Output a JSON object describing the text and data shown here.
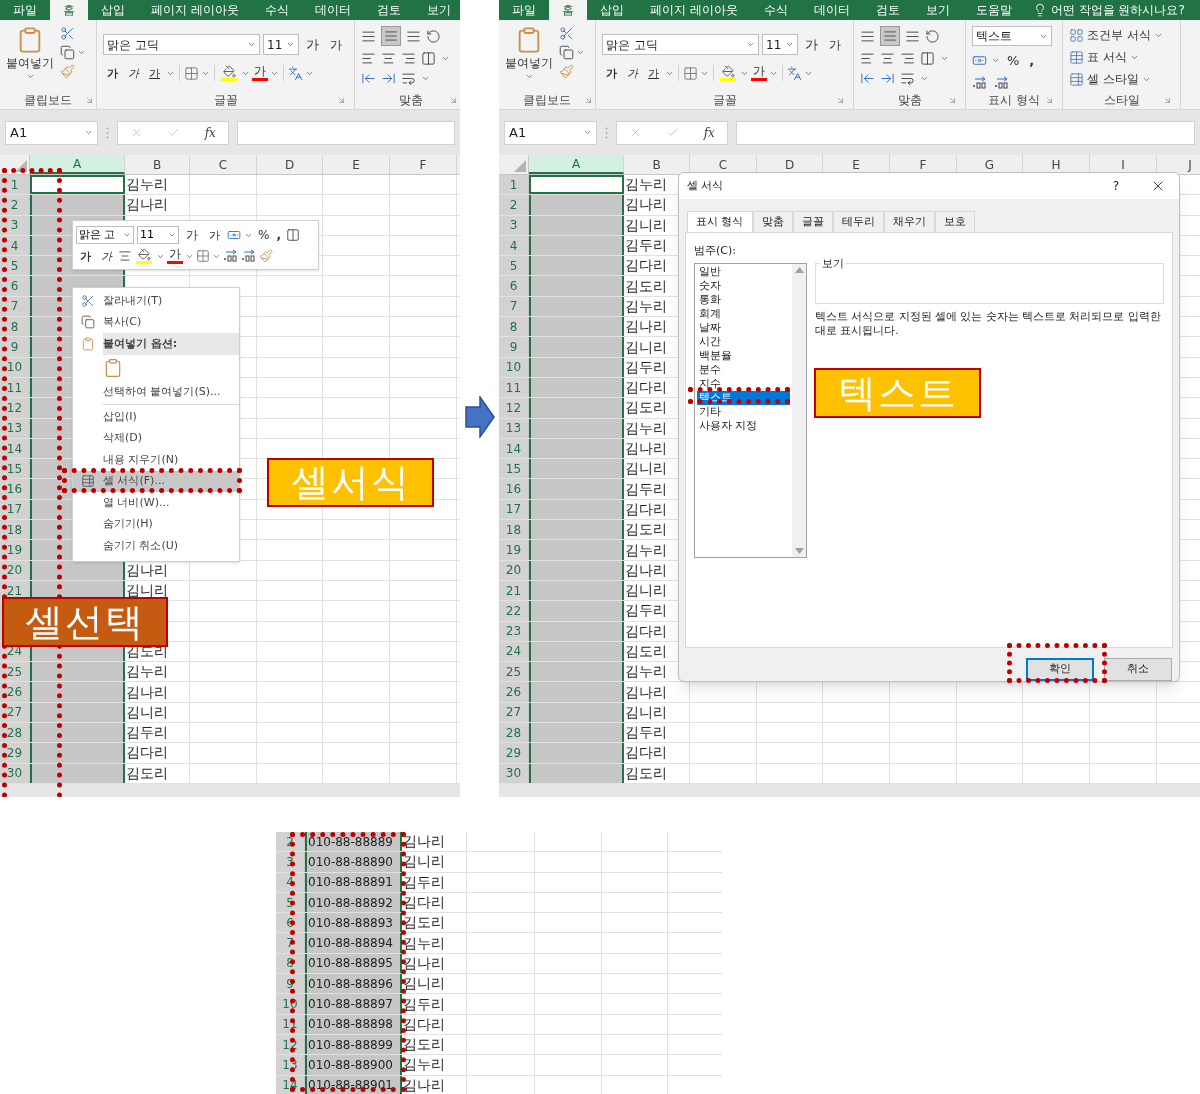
{
  "step1": {
    "tabs": [
      {
        "label": "파일",
        "selected": false
      },
      {
        "label": "홈",
        "selected": true
      },
      {
        "label": "삽입",
        "selected": false
      },
      {
        "label": "페이지 레이아웃",
        "selected": false
      },
      {
        "label": "수식",
        "selected": false
      },
      {
        "label": "데이터",
        "selected": false
      },
      {
        "label": "검토",
        "selected": false
      },
      {
        "label": "보기",
        "selected": false
      }
    ],
    "ribbon": {
      "groups": [
        {
          "kind": "clipboard",
          "label": "클립보드",
          "paste": "붙여넣기"
        },
        {
          "kind": "font",
          "label": "글꼴",
          "font_name": "맑은 고딕",
          "font_size": "11",
          "grow": "가",
          "shrink": "가",
          "bold": "가",
          "italic": "가",
          "underline": "가",
          "font_color": "가"
        },
        {
          "kind": "alignment",
          "label": "맞춤"
        }
      ]
    },
    "name_box": "A1",
    "fx": "fx",
    "columns": [
      {
        "label": "A",
        "selected": true
      },
      {
        "label": "B",
        "selected": false
      },
      {
        "label": "C",
        "selected": false
      },
      {
        "label": "D",
        "selected": false
      },
      {
        "label": "E",
        "selected": false
      },
      {
        "label": "F",
        "selected": false
      }
    ],
    "rows": [
      {
        "number": "1",
        "b": "김누리"
      },
      {
        "number": "2",
        "b": "김나리"
      },
      {
        "number": "3"
      },
      {
        "number": "4"
      },
      {
        "number": "5"
      },
      {
        "number": "6"
      },
      {
        "number": "7"
      },
      {
        "number": "8"
      },
      {
        "number": "9"
      },
      {
        "number": "10"
      },
      {
        "number": "11"
      },
      {
        "number": "12"
      },
      {
        "number": "13"
      },
      {
        "number": "14"
      },
      {
        "number": "15"
      },
      {
        "number": "16"
      },
      {
        "number": "17"
      },
      {
        "number": "18"
      },
      {
        "number": "19"
      },
      {
        "number": "20",
        "b": "김나리"
      },
      {
        "number": "21",
        "b": "김니리"
      },
      {},
      {},
      {
        "number": "24",
        "b": "김도리"
      },
      {
        "number": "25",
        "b": "김누리"
      },
      {
        "number": "26",
        "b": "김나리"
      },
      {
        "number": "27",
        "b": "김니리"
      },
      {
        "number": "28",
        "b": "김두리"
      },
      {
        "number": "29",
        "b": "김다리"
      },
      {
        "number": "30",
        "b": "김도리"
      }
    ],
    "mini_toolbar": {
      "font_name": "맑은 고",
      "font_size": "11",
      "grow": "가",
      "shrink": "가",
      "percent": "%",
      "comma": ",",
      "bold": "가",
      "italic": "가",
      "font_color": "가"
    },
    "context_menu": {
      "items": [
        {
          "kind": "item",
          "label": "잘라내기(T)",
          "selected": false
        },
        {
          "kind": "item",
          "label": "복사(C)",
          "selected": false
        },
        {
          "kind": "header",
          "label": "붙여넣기 옵션:"
        },
        {
          "kind": "paste_options"
        },
        {
          "kind": "item",
          "label": "선택하여 붙여넣기(S)...",
          "selected": false
        },
        {
          "kind": "separator"
        },
        {
          "kind": "item",
          "label": "삽입(I)",
          "selected": false
        },
        {
          "kind": "item",
          "label": "삭제(D)",
          "selected": false
        },
        {
          "kind": "item",
          "label": "내용 지우기(N)",
          "selected": false
        },
        {
          "kind": "item",
          "label": "셀 서식(F)...",
          "selected": true
        },
        {
          "kind": "item",
          "label": "열 너비(W)...",
          "selected": false
        },
        {
          "kind": "item",
          "label": "숨기기(H)",
          "selected": false
        },
        {
          "kind": "item",
          "label": "숨기기 취소(U)",
          "selected": false
        }
      ]
    },
    "callouts": [
      {
        "text": "셀서식",
        "color": "#ffc000"
      },
      {
        "text": "셀선택",
        "color": "#c55a11"
      }
    ]
  },
  "step2": {
    "tabs": [
      {
        "label": "파일",
        "selected": false
      },
      {
        "label": "홈",
        "selected": true
      },
      {
        "label": "삽입",
        "selected": false
      },
      {
        "label": "페이지 레이아웃",
        "selected": false
      },
      {
        "label": "수식",
        "selected": false
      },
      {
        "label": "데이터",
        "selected": false
      },
      {
        "label": "검토",
        "selected": false
      },
      {
        "label": "보기",
        "selected": false
      },
      {
        "label": "도움말",
        "selected": false
      }
    ],
    "tell_me": "어떤 작업을 원하시나요?",
    "ribbon": {
      "groups": [
        {
          "kind": "clipboard",
          "label": "클립보드",
          "paste": "붙여넣기"
        },
        {
          "kind": "font",
          "label": "글꼴",
          "font_name": "맑은 고딕",
          "font_size": "11",
          "grow": "가",
          "shrink": "가",
          "bold": "가",
          "italic": "가",
          "underline": "가",
          "font_color": "가"
        },
        {
          "kind": "alignment",
          "label": "맞춤"
        },
        {
          "kind": "number",
          "label": "표시 형식",
          "format": "텍스트",
          "percent": "%",
          "comma": ","
        },
        {
          "kind": "styles",
          "label": "스타일",
          "items": [
            "조건부 서식",
            "표 서식",
            "셀 스타일"
          ]
        }
      ]
    },
    "name_box": "A1",
    "fx": "fx",
    "columns": [
      {
        "label": "A",
        "selected": true
      },
      {
        "label": "B",
        "selected": false
      },
      {
        "label": "C",
        "selected": false
      },
      {
        "label": "D",
        "selected": false
      },
      {
        "label": "E",
        "selected": false
      },
      {
        "label": "F",
        "selected": false
      },
      {
        "label": "G",
        "selected": false
      },
      {
        "label": "H",
        "selected": false
      },
      {
        "label": "I",
        "selected": false
      },
      {
        "label": "J",
        "selected": false
      }
    ],
    "rows": [
      {
        "number": "1",
        "b": "김누리"
      },
      {
        "number": "2",
        "b": "김나리"
      },
      {
        "number": "3",
        "b": "김니리"
      },
      {
        "number": "4",
        "b": "김두리"
      },
      {
        "number": "5",
        "b": "김다리"
      },
      {
        "number": "6",
        "b": "김도리"
      },
      {
        "number": "7",
        "b": "김누리"
      },
      {
        "number": "8",
        "b": "김나리"
      },
      {
        "number": "9",
        "b": "김니리"
      },
      {
        "number": "10",
        "b": "김두리"
      },
      {
        "number": "11",
        "b": "김다리"
      },
      {
        "number": "12",
        "b": "김도리"
      },
      {
        "number": "13",
        "b": "김누리"
      },
      {
        "number": "14",
        "b": "김나리"
      },
      {
        "number": "15",
        "b": "김니리"
      },
      {
        "number": "16",
        "b": "김두리"
      },
      {
        "number": "17",
        "b": "김다리"
      },
      {
        "number": "18",
        "b": "김도리"
      },
      {
        "number": "19",
        "b": "김누리"
      },
      {
        "number": "20",
        "b": "김나리"
      },
      {
        "number": "21",
        "b": "김니리"
      },
      {
        "number": "22",
        "b": "김두리"
      },
      {
        "number": "23",
        "b": "김다리"
      },
      {
        "number": "24",
        "b": "김도리"
      },
      {
        "number": "25",
        "b": "김누리"
      },
      {
        "number": "26",
        "b": "김나리"
      },
      {
        "number": "27",
        "b": "김니리"
      },
      {
        "number": "28",
        "b": "김두리"
      },
      {
        "number": "29",
        "b": "김다리"
      },
      {
        "number": "30",
        "b": "김도리"
      }
    ],
    "dialog": {
      "title": "셀 서식",
      "help": "?",
      "tabs": [
        {
          "label": "표시 형식",
          "selected": true
        },
        {
          "label": "맞춤",
          "selected": false
        },
        {
          "label": "글꼴",
          "selected": false
        },
        {
          "label": "테두리",
          "selected": false
        },
        {
          "label": "채우기",
          "selected": false
        },
        {
          "label": "보호",
          "selected": false
        }
      ],
      "category_label": "범주(C):",
      "categories": [
        {
          "label": "일반",
          "selected": false
        },
        {
          "label": "숫자",
          "selected": false
        },
        {
          "label": "통화",
          "selected": false
        },
        {
          "label": "회계",
          "selected": false
        },
        {
          "label": "날짜",
          "selected": false
        },
        {
          "label": "시간",
          "selected": false
        },
        {
          "label": "백분율",
          "selected": false
        },
        {
          "label": "분수",
          "selected": false
        },
        {
          "label": "지수",
          "selected": false
        },
        {
          "label": "텍스트",
          "selected": true
        },
        {
          "label": "기타",
          "selected": false
        },
        {
          "label": "사용자 지정",
          "selected": false
        }
      ],
      "sample_label": "보기",
      "description": "텍스트 서식으로 지정된 셀에 있는 숫자는 텍스트로 처리되므로 입력한 대로 표시됩니다.",
      "buttons": [
        "확인",
        "취소"
      ]
    },
    "callout": {
      "text": "텍스트",
      "color": "#ffc000"
    }
  },
  "step3": {
    "a_selected": true,
    "rows": [
      {
        "number": "2",
        "a": "010-88-88889",
        "b": "김나리"
      },
      {
        "number": "3",
        "a": "010-88-88890",
        "b": "김니리"
      },
      {
        "number": "4",
        "a": "010-88-88891",
        "b": "김두리"
      },
      {
        "number": "5",
        "a": "010-88-88892",
        "b": "김다리"
      },
      {
        "number": "6",
        "a": "010-88-88893",
        "b": "김도리"
      },
      {
        "number": "7",
        "a": "010-88-88894",
        "b": "김누리"
      },
      {
        "number": "8",
        "a": "010-88-88895",
        "b": "김나리"
      },
      {
        "number": "9",
        "a": "010-88-88896",
        "b": "김니리"
      },
      {
        "number": "10",
        "a": "010-88-88897",
        "b": "김두리"
      },
      {
        "number": "11",
        "a": "010-88-88898",
        "b": "김다리"
      },
      {
        "number": "12",
        "a": "010-88-88899",
        "b": "김도리"
      },
      {
        "number": "13",
        "a": "010-88-88900",
        "b": "김누리"
      },
      {
        "number": "14",
        "a": "010-88-88901",
        "b": "김나리"
      }
    ]
  }
}
